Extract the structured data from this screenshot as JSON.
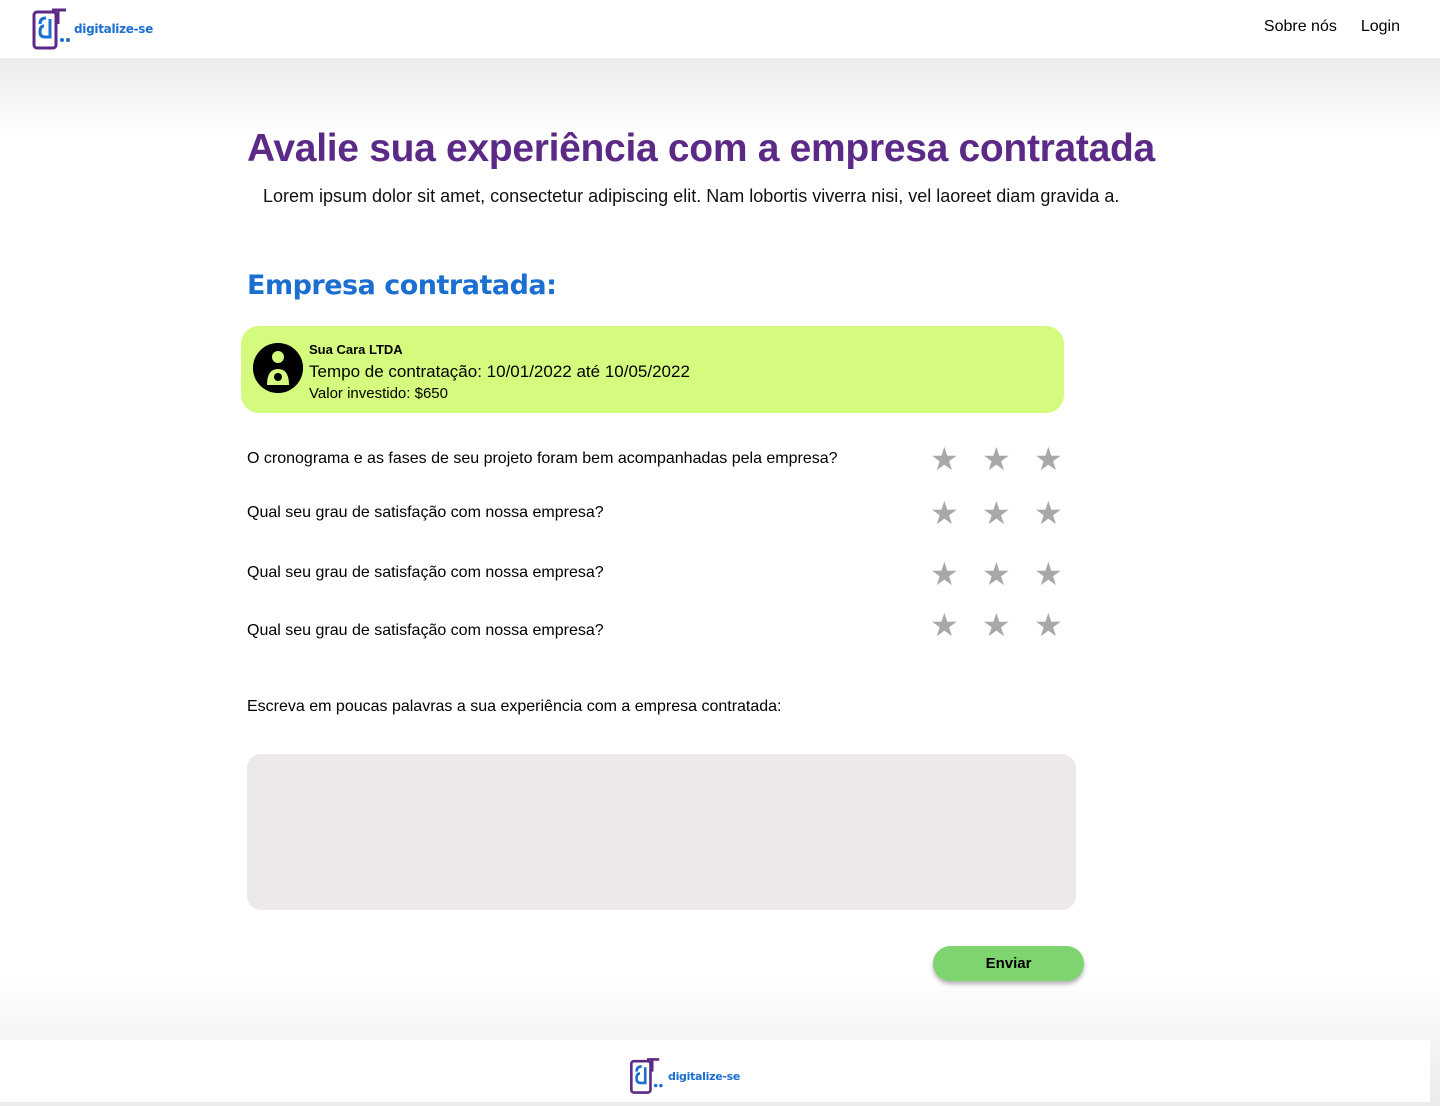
{
  "header": {
    "brand": "digitalize-se",
    "nav": [
      {
        "label": "Sobre nós"
      },
      {
        "label": "Login"
      }
    ]
  },
  "main": {
    "title": "Avalie sua experiência com a empresa contratada",
    "subtitle": "Lorem ipsum dolor sit amet, consectetur adipiscing elit. Nam lobortis viverra nisi, vel laoreet diam gravida a.",
    "section_title": "Empresa contratada:",
    "company": {
      "name": "Sua Cara LTDA",
      "period": "Tempo de contratação: 10/01/2022 até 10/05/2022",
      "value": "Valor investido: $650",
      "avatar_icon": "user-avatar-icon"
    },
    "questions": [
      {
        "text": "O cronograma e as fases de seu projeto foram bem acompanhadas pela empresa?",
        "stars": 3,
        "rating": 0
      },
      {
        "text": "Qual seu grau de satisfação com nossa empresa?",
        "stars": 3,
        "rating": 0
      },
      {
        "text": "Qual seu grau de satisfação com nossa empresa?",
        "stars": 3,
        "rating": 0
      },
      {
        "text": "Qual seu grau de satisfação com nossa empresa?",
        "stars": 3,
        "rating": 0
      }
    ],
    "prompt": "Escreva em poucas palavras a sua experiência com a empresa contratada:",
    "textarea_value": "",
    "submit_label": "Enviar"
  },
  "footer": {
    "brand": "digitalize-se"
  },
  "colors": {
    "title": "#5b2a86",
    "section_title": "#1a6fd1",
    "card": "#d4fb7e",
    "button": "#7ed56f",
    "star_inactive": "#a8a8a8",
    "textarea": "#ede9e8"
  }
}
